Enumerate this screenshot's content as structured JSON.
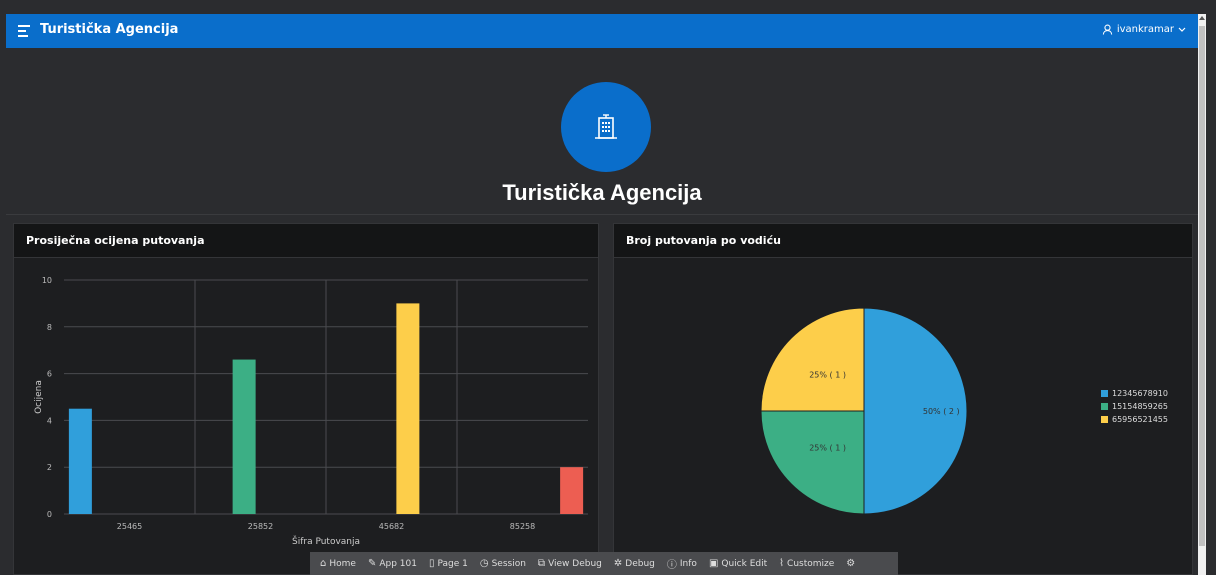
{
  "header": {
    "app_title": "Turistička Agencija",
    "username": "ivankramar"
  },
  "hero": {
    "title": "Turistička Agencija",
    "icon": "building-icon"
  },
  "charts": {
    "bar_title": "Prosiječna ocijena putovanja",
    "pie_title": "Broj putovanja po vodiću"
  },
  "chart_data": [
    {
      "type": "bar",
      "title": "Prosiječna ocijena putovanja",
      "xlabel": "Šifra Putovanja",
      "ylabel": "Ocijena",
      "ylim": [
        0,
        10
      ],
      "yticks": [
        0,
        2,
        4,
        6,
        8,
        10
      ],
      "categories": [
        "25465",
        "25852",
        "45682",
        "85258"
      ],
      "values": [
        4.5,
        6.6,
        9,
        2
      ],
      "colors": [
        "#309fdb",
        "#3caf85",
        "#fdce4a",
        "#ed5e52"
      ],
      "grid": true
    },
    {
      "type": "pie",
      "title": "Broj putovanja po vodiću",
      "labels": [
        "12345678910",
        "15154859265",
        "65956521455"
      ],
      "values": [
        2,
        1,
        1
      ],
      "slice_labels": [
        "50% ( 2 )",
        "25% ( 1 )",
        "25% ( 1 )"
      ],
      "colors": [
        "#309fdb",
        "#3caf85",
        "#fdce4a"
      ],
      "legend": "right"
    }
  ],
  "devbar": {
    "items": [
      "Home",
      "App 101",
      "Page 1",
      "Session",
      "View Debug",
      "Debug",
      "Info",
      "Quick Edit",
      "Customize"
    ]
  }
}
